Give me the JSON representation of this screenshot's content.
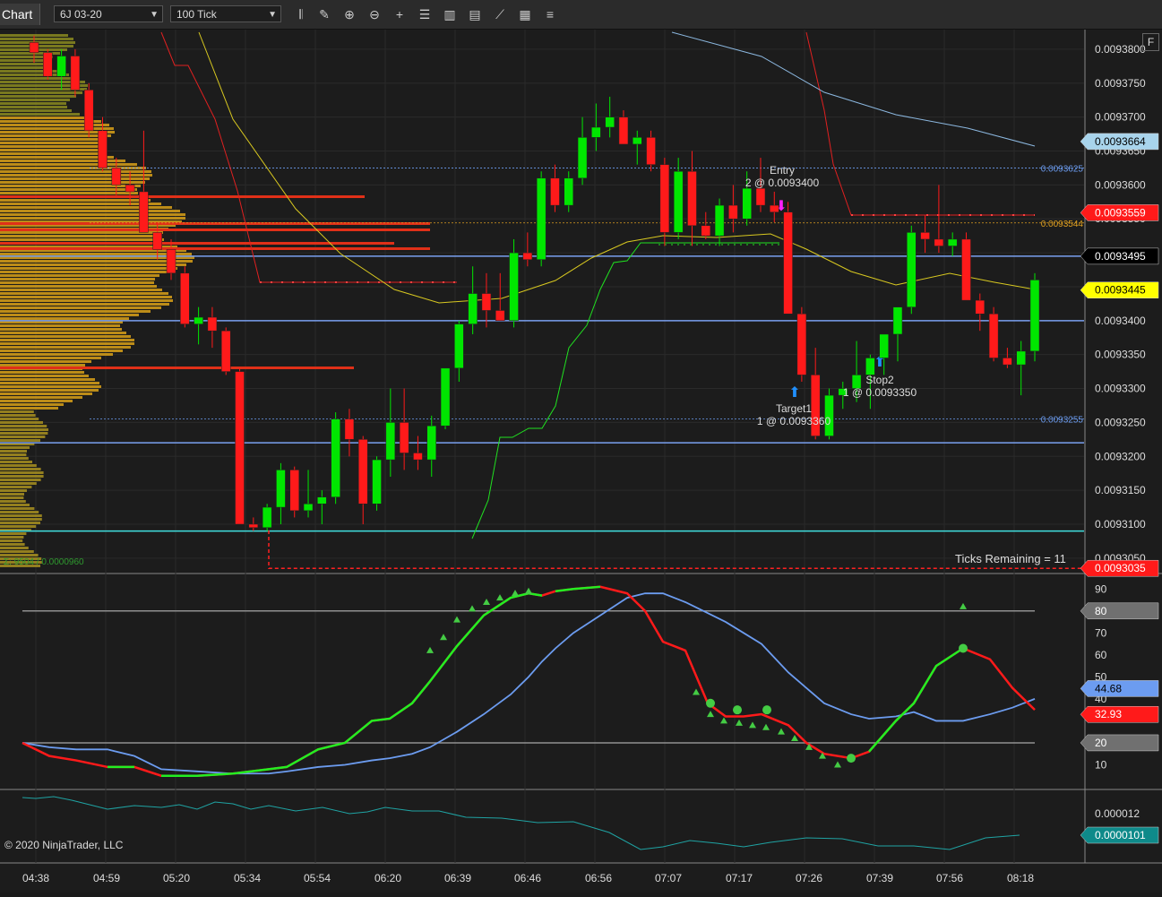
{
  "toolbar": {
    "tab_label": "Chart",
    "instrument": "6J 03-20",
    "interval": "100 Tick",
    "icons": [
      "bar-type-icon",
      "pencil-icon",
      "zoom-in-icon",
      "zoom-out-icon",
      "crosshair-icon",
      "properties-icon",
      "data-series-icon",
      "strategy-icon",
      "indicators-icon",
      "templates-icon",
      "list-icon"
    ]
  },
  "price_panel": {
    "ylim": [
      0.009303,
      0.0093825
    ],
    "ticks": [
      "0.0093800",
      "0.0093750",
      "0.0093700",
      "0.0093650",
      "0.0093600",
      "0.0093550",
      "0.0093500",
      "0.0093450",
      "0.0093400",
      "0.0093350",
      "0.0093300",
      "0.0093250",
      "0.0093200",
      "0.0093150",
      "0.0093100",
      "0.0093050"
    ],
    "tick_values": [
      0.00938,
      0.009375,
      0.00937,
      0.009365,
      0.00936,
      0.009355,
      0.00935,
      0.009345,
      0.00934,
      0.009335,
      0.00933,
      0.009325,
      0.00932,
      0.009315,
      0.00931,
      0.009305
    ],
    "tags": [
      {
        "text": "0.0093664",
        "value": 0.0093664,
        "bg": "#a8d4ec",
        "fg": "#000"
      },
      {
        "text": "0.0093559",
        "value": 0.0093559,
        "bg": "#ff1a1a",
        "fg": "#fff"
      },
      {
        "text": "0.0093495",
        "value": 0.0093495,
        "bg": "#000000",
        "fg": "#fff"
      },
      {
        "text": "0.0093445",
        "value": 0.0093445,
        "bg": "#ffff00",
        "fg": "#000"
      },
      {
        "text": "0.0093035",
        "value": 0.0093035,
        "bg": "#ff1a1a",
        "fg": "#fff"
      }
    ],
    "inline_labels": [
      {
        "text": "0.0093625",
        "value": 0.0093625,
        "color": "#6c9cf0"
      },
      {
        "text": "0.0093544",
        "value": 0.0093544,
        "color": "#e0a020"
      },
      {
        "text": "0.0093255",
        "value": 0.0093255,
        "color": "#6c9cf0"
      }
    ],
    "entry": {
      "title": "Entry",
      "detail": "2 @ 0.0093400"
    },
    "target": {
      "title": "Target1",
      "detail": "1 @ 0.0093360"
    },
    "stop": {
      "title": "Stop2",
      "detail": "1 @ 0.0093350"
    },
    "ticks_remaining": "Ticks Remaining = 11",
    "volume_summary": "Σ: 9504 / 0.0000960",
    "flag": "F"
  },
  "osc_panel": {
    "ylim": [
      0,
      95
    ],
    "ticks": [
      "90",
      "70",
      "60",
      "50",
      "40",
      "10"
    ],
    "tick_values": [
      90,
      70,
      60,
      50,
      40,
      10
    ],
    "tags": [
      {
        "text": "80",
        "value": 80,
        "bg": "#707070",
        "fg": "#fff"
      },
      {
        "text": "44.68",
        "value": 44.68,
        "bg": "#6c9cf0",
        "fg": "#000"
      },
      {
        "text": "32.93",
        "value": 32.93,
        "bg": "#ff1a1a",
        "fg": "#fff"
      },
      {
        "text": "20",
        "value": 20,
        "bg": "#707070",
        "fg": "#fff"
      }
    ]
  },
  "low_panel": {
    "ticks": [
      "0.000012"
    ],
    "tag": {
      "text": "0.0000101",
      "bg": "#0e8a8a",
      "fg": "#fff"
    }
  },
  "copyright": "© 2020 NinjaTrader, LLC",
  "time_axis": [
    "04:38",
    "04:59",
    "05:20",
    "05:34",
    "05:54",
    "06:20",
    "06:39",
    "06:46",
    "06:56",
    "07:07",
    "07:17",
    "07:26",
    "07:39",
    "07:56",
    "08:18"
  ],
  "chart_data": {
    "type": "candlestick",
    "candles": [
      [
        0.009381,
        0.009382,
        0.009378,
        0.0093795
      ],
      [
        0.0093795,
        0.00938,
        0.0093755,
        0.009376
      ],
      [
        0.009376,
        0.00938,
        0.009374,
        0.009379
      ],
      [
        0.009379,
        0.00938,
        0.009373,
        0.009374
      ],
      [
        0.009374,
        0.009375,
        0.009367,
        0.009368
      ],
      [
        0.009368,
        0.00937,
        0.009362,
        0.0093625
      ],
      [
        0.0093625,
        0.009364,
        0.0093585,
        0.00936
      ],
      [
        0.00936,
        0.009362,
        0.009357,
        0.009359
      ],
      [
        0.009359,
        0.009368,
        0.009353,
        0.009353
      ],
      [
        0.009353,
        0.0093545,
        0.009349,
        0.0093505
      ],
      [
        0.0093505,
        0.009352,
        0.009346,
        0.009347
      ],
      [
        0.009347,
        0.009348,
        0.009339,
        0.0093395
      ],
      [
        0.0093395,
        0.009342,
        0.0093365,
        0.0093405
      ],
      [
        0.0093405,
        0.009342,
        0.009336,
        0.0093385
      ],
      [
        0.0093385,
        0.009339,
        0.009332,
        0.0093325
      ],
      [
        0.0093325,
        0.009333,
        0.00931,
        0.00931
      ],
      [
        0.00931,
        0.009311,
        0.009309,
        0.0093095
      ],
      [
        0.0093095,
        0.009313,
        0.009309,
        0.0093125
      ],
      [
        0.0093125,
        0.009319,
        0.00931,
        0.009318
      ],
      [
        0.009318,
        0.0093185,
        0.009311,
        0.009312
      ],
      [
        0.009312,
        0.009318,
        0.009311,
        0.009313
      ],
      [
        0.009313,
        0.009315,
        0.00931,
        0.009314
      ],
      [
        0.009314,
        0.0093265,
        0.009313,
        0.0093255
      ],
      [
        0.0093255,
        0.009327,
        0.00932,
        0.0093225
      ],
      [
        0.0093225,
        0.009323,
        0.00931,
        0.009313
      ],
      [
        0.009313,
        0.00932,
        0.009312,
        0.0093195
      ],
      [
        0.0093195,
        0.00933,
        0.009317,
        0.009325
      ],
      [
        0.009325,
        0.00933,
        0.009318,
        0.0093205
      ],
      [
        0.0093205,
        0.009323,
        0.009318,
        0.0093195
      ],
      [
        0.0093195,
        0.009326,
        0.009317,
        0.0093245
      ],
      [
        0.0093245,
        0.009333,
        0.009324,
        0.009333
      ],
      [
        0.009333,
        0.00934,
        0.009331,
        0.0093395
      ],
      [
        0.0093395,
        0.009348,
        0.009338,
        0.009344
      ],
      [
        0.009344,
        0.009347,
        0.009339,
        0.0093415
      ],
      [
        0.0093415,
        0.009347,
        0.00934,
        0.00934
      ],
      [
        0.00934,
        0.009352,
        0.009339,
        0.00935
      ],
      [
        0.00935,
        0.009353,
        0.009348,
        0.009349
      ],
      [
        0.009349,
        0.009362,
        0.009348,
        0.009361
      ],
      [
        0.009361,
        0.009363,
        0.009356,
        0.009357
      ],
      [
        0.009357,
        0.009362,
        0.009356,
        0.009361
      ],
      [
        0.009361,
        0.00937,
        0.00936,
        0.009367
      ],
      [
        0.009367,
        0.009372,
        0.009365,
        0.0093685
      ],
      [
        0.0093685,
        0.009373,
        0.009367,
        0.00937
      ],
      [
        0.00937,
        0.009371,
        0.009366,
        0.009366
      ],
      [
        0.009366,
        0.009368,
        0.009363,
        0.009367
      ],
      [
        0.009367,
        0.009368,
        0.009362,
        0.009363
      ],
      [
        0.009363,
        0.009364,
        0.009351,
        0.009353
      ],
      [
        0.009353,
        0.009364,
        0.009352,
        0.009362
      ],
      [
        0.009362,
        0.009365,
        0.009351,
        0.009354
      ],
      [
        0.009354,
        0.009356,
        0.009352,
        0.0093525
      ],
      [
        0.0093525,
        0.009358,
        0.009351,
        0.009357
      ],
      [
        0.009357,
        0.00936,
        0.009353,
        0.009355
      ],
      [
        0.009355,
        0.009362,
        0.009354,
        0.0093595
      ],
      [
        0.0093595,
        0.009364,
        0.009356,
        0.009357
      ],
      [
        0.009357,
        0.009359,
        0.0093545,
        0.009356
      ],
      [
        0.009356,
        0.0093575,
        0.009342,
        0.009341
      ],
      [
        0.009341,
        0.009342,
        0.009331,
        0.009332
      ],
      [
        0.009332,
        0.009336,
        0.0093225,
        0.009323
      ],
      [
        0.009323,
        0.00933,
        0.0093225,
        0.009329
      ],
      [
        0.009329,
        0.009331,
        0.009327,
        0.00933
      ],
      [
        0.00933,
        0.009337,
        0.009328,
        0.009332
      ],
      [
        0.009332,
        0.009335,
        0.009327,
        0.0093345
      ],
      [
        0.0093345,
        0.009338,
        0.009332,
        0.009338
      ],
      [
        0.009338,
        0.009342,
        0.009334,
        0.009342
      ],
      [
        0.009342,
        0.009354,
        0.009341,
        0.009353
      ],
      [
        0.009353,
        0.0093555,
        0.00935,
        0.009352
      ],
      [
        0.009352,
        0.00936,
        0.00935,
        0.009351
      ],
      [
        0.009351,
        0.009353,
        0.0093495,
        0.009352
      ],
      [
        0.009352,
        0.009353,
        0.009346,
        0.009343
      ],
      [
        0.009343,
        0.009344,
        0.0093385,
        0.009341
      ],
      [
        0.009341,
        0.009342,
        0.009334,
        0.0093345
      ],
      [
        0.0093345,
        0.009336,
        0.009333,
        0.0093335
      ],
      [
        0.0093335,
        0.009337,
        0.009329,
        0.0093355
      ],
      [
        0.0093355,
        0.009347,
        0.009334,
        0.009346
      ]
    ],
    "up_color": "#00e600",
    "down_color": "#ff1a1a"
  }
}
